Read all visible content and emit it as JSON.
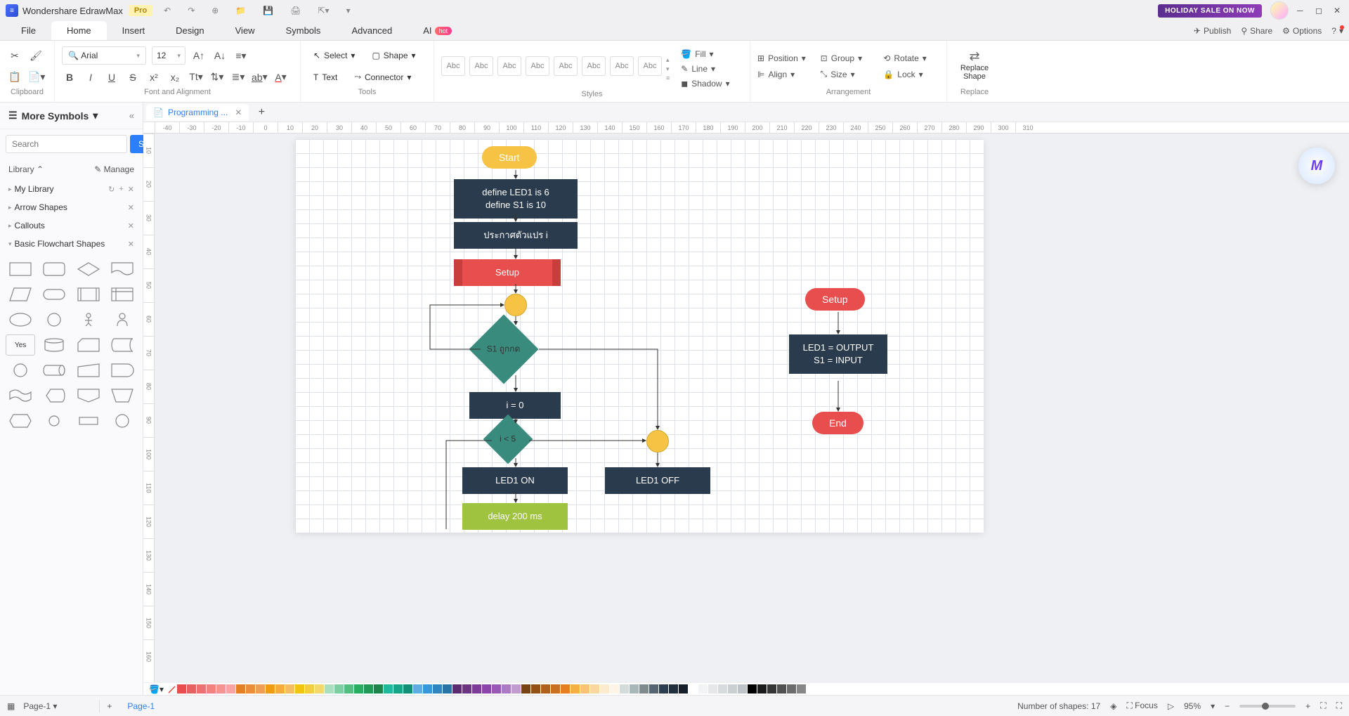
{
  "titlebar": {
    "app_name": "Wondershare EdrawMax",
    "pro_badge": "Pro",
    "holiday": "HOLIDAY SALE ON NOW"
  },
  "menu": {
    "file": "File",
    "home": "Home",
    "insert": "Insert",
    "design": "Design",
    "view": "View",
    "symbols": "Symbols",
    "advanced": "Advanced",
    "ai": "AI",
    "hot": "hot",
    "publish": "Publish",
    "share": "Share",
    "options": "Options"
  },
  "ribbon": {
    "clipboard": "Clipboard",
    "font_alignment": "Font and Alignment",
    "font_name": "Arial",
    "font_size": "12",
    "tools": "Tools",
    "select": "Select",
    "shape": "Shape",
    "text": "Text",
    "connector": "Connector",
    "styles": "Styles",
    "style_label": "Abc",
    "fill": "Fill",
    "line": "Line",
    "shadow": "Shadow",
    "arrangement": "Arrangement",
    "position": "Position",
    "align": "Align",
    "group": "Group",
    "size": "Size",
    "rotate": "Rotate",
    "lock": "Lock",
    "replace": "Replace",
    "replace_shape": "Shape"
  },
  "sidebar": {
    "title": "More Symbols",
    "search_placeholder": "Search",
    "search_btn": "Search",
    "library": "Library",
    "manage": "Manage",
    "my_library": "My Library",
    "arrow_shapes": "Arrow Shapes",
    "callouts": "Callouts",
    "basic_flowchart": "Basic Flowchart Shapes",
    "yes": "Yes"
  },
  "doc": {
    "tab_name": "Programming ..."
  },
  "ruler_h": [
    "-40",
    "-30",
    "-20",
    "-10",
    "0",
    "10",
    "20",
    "30",
    "40",
    "50",
    "60",
    "70",
    "80",
    "90",
    "100",
    "110",
    "120",
    "130",
    "140",
    "150",
    "160",
    "170",
    "180",
    "190",
    "200",
    "210",
    "220",
    "230",
    "240",
    "250",
    "260",
    "270",
    "280",
    "290",
    "300",
    "310"
  ],
  "ruler_v": [
    "10",
    "20",
    "30",
    "40",
    "50",
    "60",
    "70",
    "80",
    "90",
    "100",
    "110",
    "120",
    "130",
    "140",
    "150",
    "160"
  ],
  "flowchart": {
    "start": "Start",
    "define": "define LED1 is 6\ndefine S1 is 10",
    "declare": "ประกาศตัวแปร i",
    "setup": "Setup",
    "decision1": "S1 ถูกกด",
    "i_eq_0": "i = 0",
    "i_lt_5": "i < 5",
    "led_on": "LED1 ON",
    "led_off": "LED1 OFF",
    "delay": "delay 200 ms",
    "setup2": "Setup",
    "io": "LED1 = OUTPUT\nS1 = INPUT",
    "end": "End"
  },
  "colors": [
    "#ffffff",
    "#e84e4e",
    "#f06060",
    "#f07070",
    "#f58080",
    "#fa9090",
    "#e67e22",
    "#f39c12",
    "#f1c40f",
    "#f9e79f",
    "#fdebd0",
    "#d5f5e3",
    "#a9dfbf",
    "#7dcea0",
    "#52be80",
    "#27ae60",
    "#1abc9c",
    "#48c9b0",
    "#76d7c4",
    "#a3e4d7",
    "#d1f2eb",
    "#5dade2",
    "#3498db",
    "#2e86c1",
    "#2874a6",
    "#21618c",
    "#8e44ad",
    "#9b59b6",
    "#af7ac5",
    "#c39bd3",
    "#d7bde2",
    "#f5b7b1",
    "#fadbd8",
    "#000000",
    "#555555",
    "#888888",
    "#bbbbbb",
    "#ffffff"
  ],
  "colors_full": [
    "#e84e4e",
    "#ec5f5f",
    "#ef7070",
    "#f28282",
    "#f59393",
    "#f8a4a4",
    "#e67e22",
    "#eb8e3c",
    "#f09e56",
    "#f39c12",
    "#f5ac3a",
    "#f7bc62",
    "#f1c40f",
    "#f3ce3d",
    "#f5d86b",
    "#a9dfbf",
    "#7dcea0",
    "#52be80",
    "#27ae60",
    "#229954",
    "#1e8449",
    "#1abc9c",
    "#17a589",
    "#148f77",
    "#5dade2",
    "#3498db",
    "#2e86c1",
    "#2874a6",
    "#5b2c6f",
    "#6c3483",
    "#7d3c98",
    "#8e44ad",
    "#9b59b6",
    "#af7ac5",
    "#c39bd3",
    "#784212",
    "#935116",
    "#af601a",
    "#ca6f1e",
    "#e67e22",
    "#f5b041",
    "#f8c471",
    "#fad7a0",
    "#fdebd0",
    "#fef5e7",
    "#d5dbdb",
    "#aab7b8",
    "#808b8d",
    "#566573",
    "#2c3e50",
    "#212f3d",
    "#17202a",
    "#ffffff",
    "#f2f3f4",
    "#e5e7e9",
    "#d7dbdd",
    "#cacfd2",
    "#bdc3c7",
    "#000000",
    "#1b1b1b",
    "#363636",
    "#515151",
    "#6c6c6c",
    "#878787"
  ],
  "status": {
    "page": "Page-1",
    "page_tab": "Page-1",
    "shapes_count": "Number of shapes: 17",
    "focus": "Focus",
    "zoom": "95%"
  }
}
